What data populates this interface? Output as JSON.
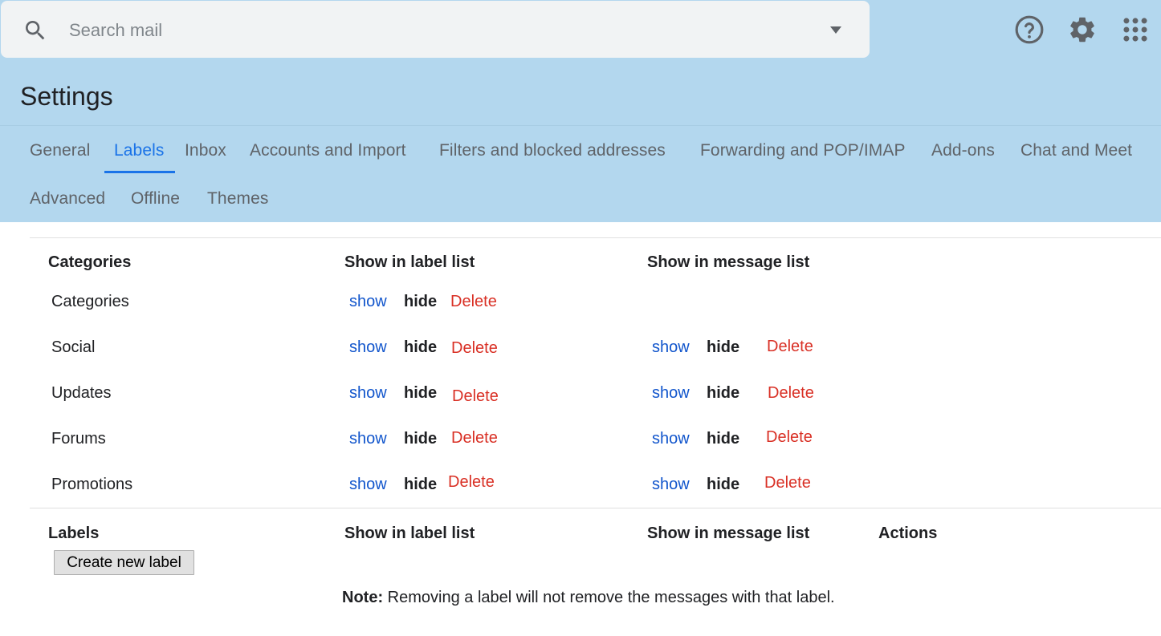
{
  "search": {
    "placeholder": "Search mail",
    "icons": {
      "search": "search-icon",
      "options": "caret-down-icon"
    }
  },
  "top_icons": [
    "help-icon",
    "gear-icon",
    "apps-grid-icon"
  ],
  "colors": {
    "header_bg": "#b3d7ee",
    "active_tab": "#1a73e8",
    "link_blue": "#1155cc",
    "delete_red": "#d93025"
  },
  "page_title": "Settings",
  "tabs": [
    {
      "label": "General",
      "active": false
    },
    {
      "label": "Labels",
      "active": true
    },
    {
      "label": "Inbox",
      "active": false
    },
    {
      "label": "Accounts and Import",
      "active": false
    },
    {
      "label": "Filters and blocked addresses",
      "active": false
    },
    {
      "label": "Forwarding and POP/IMAP",
      "active": false
    },
    {
      "label": "Add-ons",
      "active": false
    },
    {
      "label": "Chat and Meet",
      "active": false
    },
    {
      "label": "Advanced",
      "active": false
    },
    {
      "label": "Offline",
      "active": false
    },
    {
      "label": "Themes",
      "active": false
    }
  ],
  "categories": {
    "headers": {
      "name": "Categories",
      "label_list": "Show in label list",
      "message_list": "Show in message list"
    },
    "rows": [
      {
        "name": "Categories",
        "label_list": {
          "show": "show",
          "hide": "hide",
          "delete": "Delete"
        }
      },
      {
        "name": "Social",
        "label_list": {
          "show": "show",
          "hide": "hide",
          "delete": "Delete"
        },
        "message_list": {
          "show": "show",
          "hide": "hide",
          "delete": "Delete"
        }
      },
      {
        "name": "Updates",
        "label_list": {
          "show": "show",
          "hide": "hide",
          "delete": "Delete"
        },
        "message_list": {
          "show": "show",
          "hide": "hide",
          "delete": "Delete"
        }
      },
      {
        "name": "Forums",
        "label_list": {
          "show": "show",
          "hide": "hide",
          "delete": "Delete"
        },
        "message_list": {
          "show": "show",
          "hide": "hide",
          "delete": "Delete"
        }
      },
      {
        "name": "Promotions",
        "label_list": {
          "show": "show",
          "hide": "hide",
          "delete": "Delete"
        },
        "message_list": {
          "show": "show",
          "hide": "hide",
          "delete": "Delete"
        }
      }
    ]
  },
  "labels": {
    "headers": {
      "name": "Labels",
      "label_list": "Show in label list",
      "message_list": "Show in message list",
      "actions": "Actions"
    },
    "create_button": "Create new label",
    "note_prefix": "Note:",
    "note_text": " Removing a label will not remove the messages with that label."
  }
}
